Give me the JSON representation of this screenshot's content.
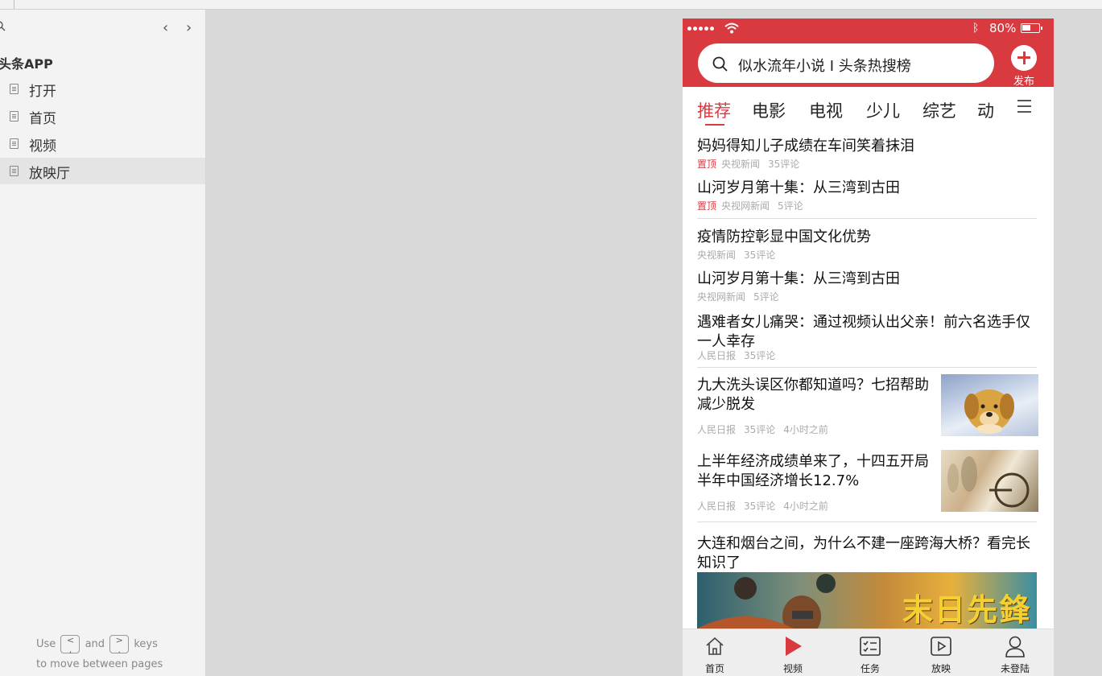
{
  "sidebar": {
    "title": "头条APP",
    "items": [
      {
        "label": "打开"
      },
      {
        "label": "首页"
      },
      {
        "label": "视频"
      },
      {
        "label": "放映厅"
      }
    ],
    "hint_use": "Use",
    "hint_and": "and",
    "hint_keys": "keys",
    "hint_line2": "to move between pages"
  },
  "status": {
    "battery": "80%"
  },
  "header": {
    "search_text": "似水流年小说 I 头条热搜榜",
    "publish_label": "发布"
  },
  "tabs": [
    "推荐",
    "电影",
    "电视",
    "少儿",
    "综艺",
    "动"
  ],
  "feed": [
    {
      "title": "妈妈得知儿子成绩在车间笑着抹泪",
      "pin": "置顶",
      "source": "央视新闻",
      "comments": "35评论"
    },
    {
      "title": "山河岁月第十集：从三湾到古田",
      "pin": "置顶",
      "source": "央视网新闻",
      "comments": "5评论"
    },
    {
      "title": "疫情防控彰显中国文化优势",
      "source": "央视新闻",
      "comments": "35评论"
    },
    {
      "title": "山河岁月第十集：从三湾到古田",
      "source": "央视网新闻",
      "comments": "5评论"
    },
    {
      "title": "遇难者女儿痛哭：通过视频认出父亲！前六名选手仅一人幸存",
      "source": "人民日报",
      "comments": "35评论"
    },
    {
      "title": "九大洗头误区你都知道吗？七招帮助减少脱发",
      "source": "人民日报",
      "comments": "35评论",
      "time": "4小时之前"
    },
    {
      "title": "上半年经济成绩单来了，十四五开局半年中国经济增长12.7%",
      "source": "人民日报",
      "comments": "35评论",
      "time": "4小时之前"
    },
    {
      "title": "大连和烟台之间，为什么不建一座跨海大桥？看完长知识了",
      "banner_text": "末日先鋒"
    }
  ],
  "bottom_nav": [
    {
      "label": "首页",
      "icon": "home-icon"
    },
    {
      "label": "视频",
      "icon": "play-triangle-icon"
    },
    {
      "label": "任务",
      "icon": "task-list-icon"
    },
    {
      "label": "放映",
      "icon": "play-box-icon"
    },
    {
      "label": "未登陆",
      "icon": "user-icon"
    }
  ],
  "colors": {
    "brand": "#d93a40"
  }
}
